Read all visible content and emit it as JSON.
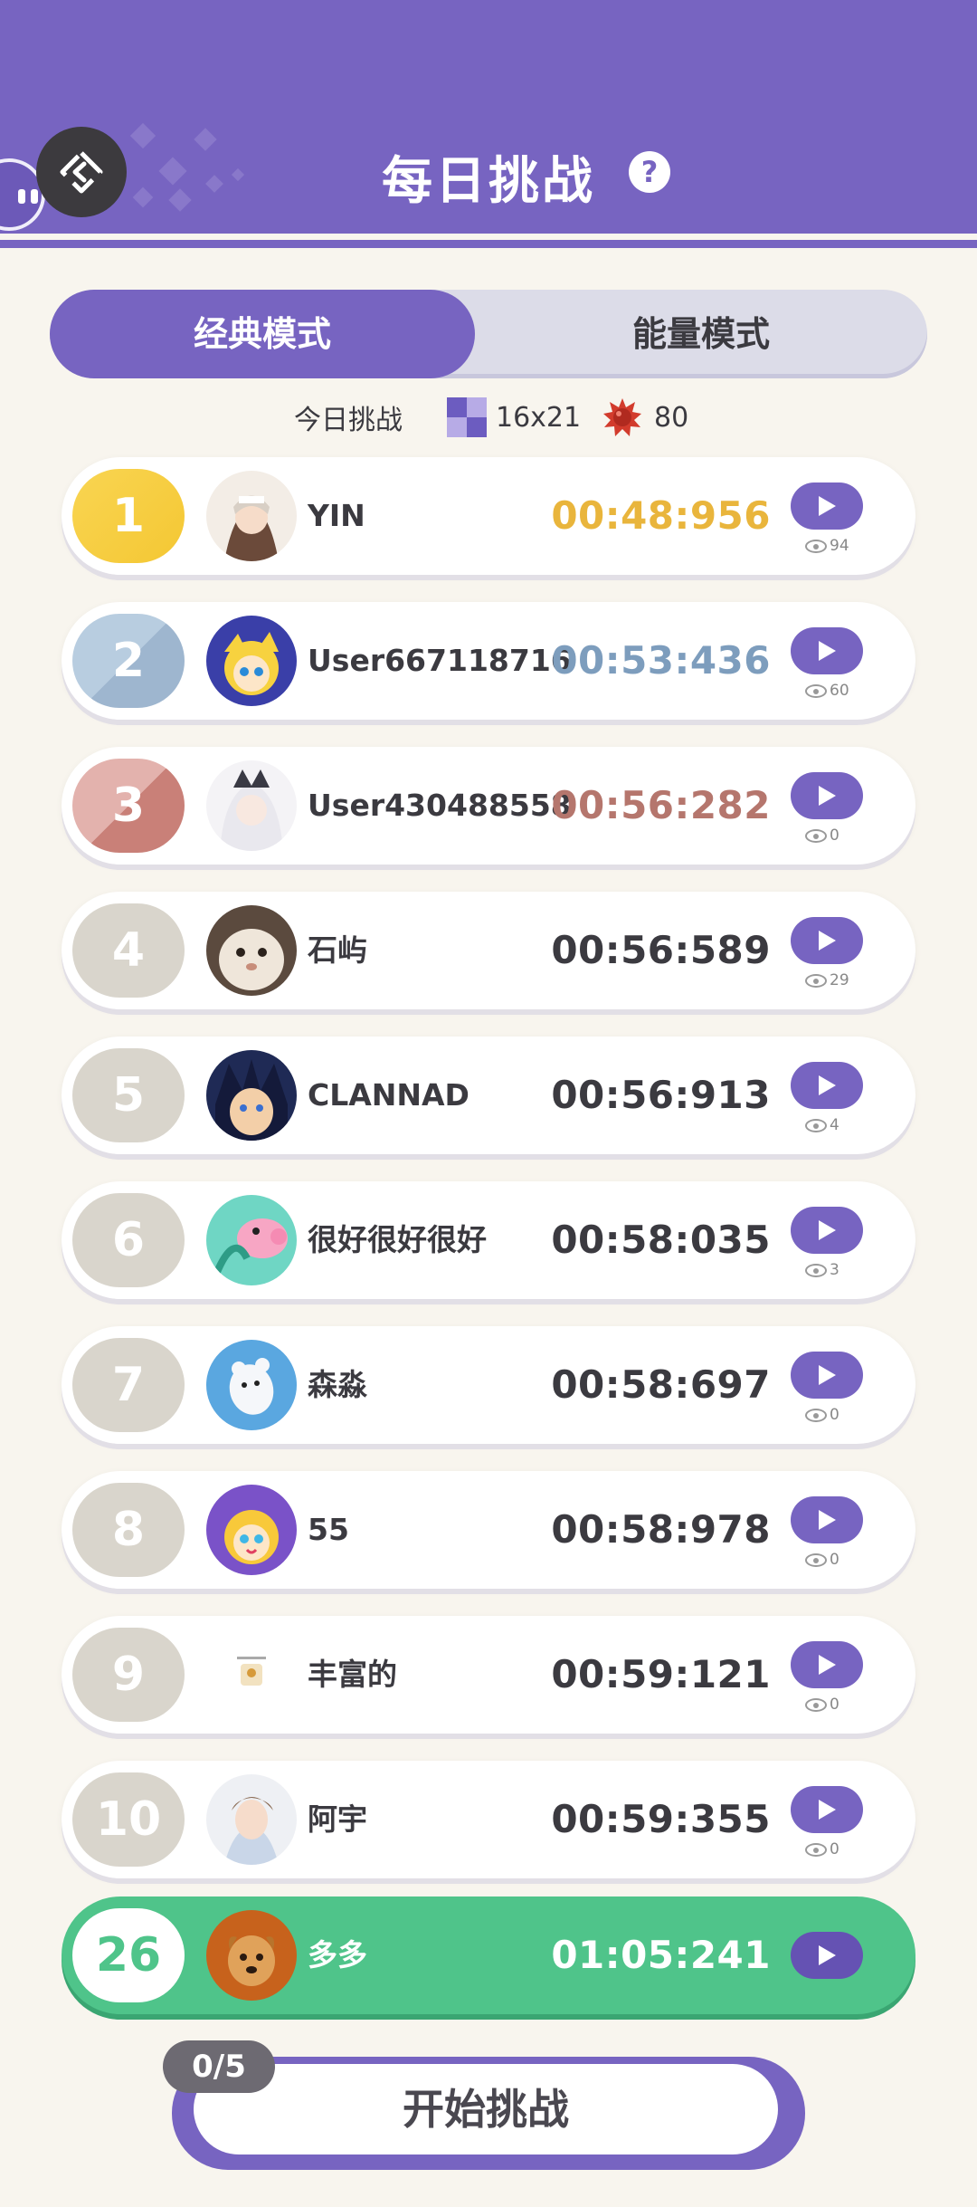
{
  "header": {
    "title": "每日挑战",
    "help_icon": "question-icon",
    "back_icon": "diamond-arrow-left-icon",
    "bg_color": "#7764c1"
  },
  "tabs": [
    {
      "label": "经典模式",
      "active": true
    },
    {
      "label": "能量模式",
      "active": false
    }
  ],
  "challenge_info": {
    "label": "今日挑战",
    "grid_size": "16x21",
    "mines": "80"
  },
  "leaderboard": [
    {
      "rank": "1",
      "name": "YIN",
      "time": "00:48:956",
      "views": "94",
      "time_color": "#e9b53c"
    },
    {
      "rank": "2",
      "name": "User667118716",
      "time": "00:53:436",
      "views": "60",
      "time_color": "#7d9dbd"
    },
    {
      "rank": "3",
      "name": "User430488558",
      "time": "00:56:282",
      "views": "0",
      "time_color": "#b5766d"
    },
    {
      "rank": "4",
      "name": "石屿",
      "time": "00:56:589",
      "views": "29",
      "time_color": "#3b3a40"
    },
    {
      "rank": "5",
      "name": "CLANNAD",
      "time": "00:56:913",
      "views": "4",
      "time_color": "#3b3a40"
    },
    {
      "rank": "6",
      "name": "很好很好很好",
      "time": "00:58:035",
      "views": "3",
      "time_color": "#3b3a40"
    },
    {
      "rank": "7",
      "name": "森淼",
      "time": "00:58:697",
      "views": "0",
      "time_color": "#3b3a40"
    },
    {
      "rank": "8",
      "name": "55",
      "time": "00:58:978",
      "views": "0",
      "time_color": "#3b3a40"
    },
    {
      "rank": "9",
      "name": "丰富的",
      "time": "00:59:121",
      "views": "0",
      "time_color": "#3b3a40"
    },
    {
      "rank": "10",
      "name": "阿宇",
      "time": "00:59:355",
      "views": "0",
      "time_color": "#3b3a40"
    }
  ],
  "my_entry": {
    "rank": "26",
    "name": "多多",
    "time": "01:05:241"
  },
  "start": {
    "label": "开始挑战",
    "attempts": "0/5"
  },
  "colors": {
    "accent": "#7764c1",
    "gold": "#f4c733",
    "silver": "#9eb6cf",
    "bronze": "#c98078",
    "self_highlight": "#4fc48a"
  }
}
